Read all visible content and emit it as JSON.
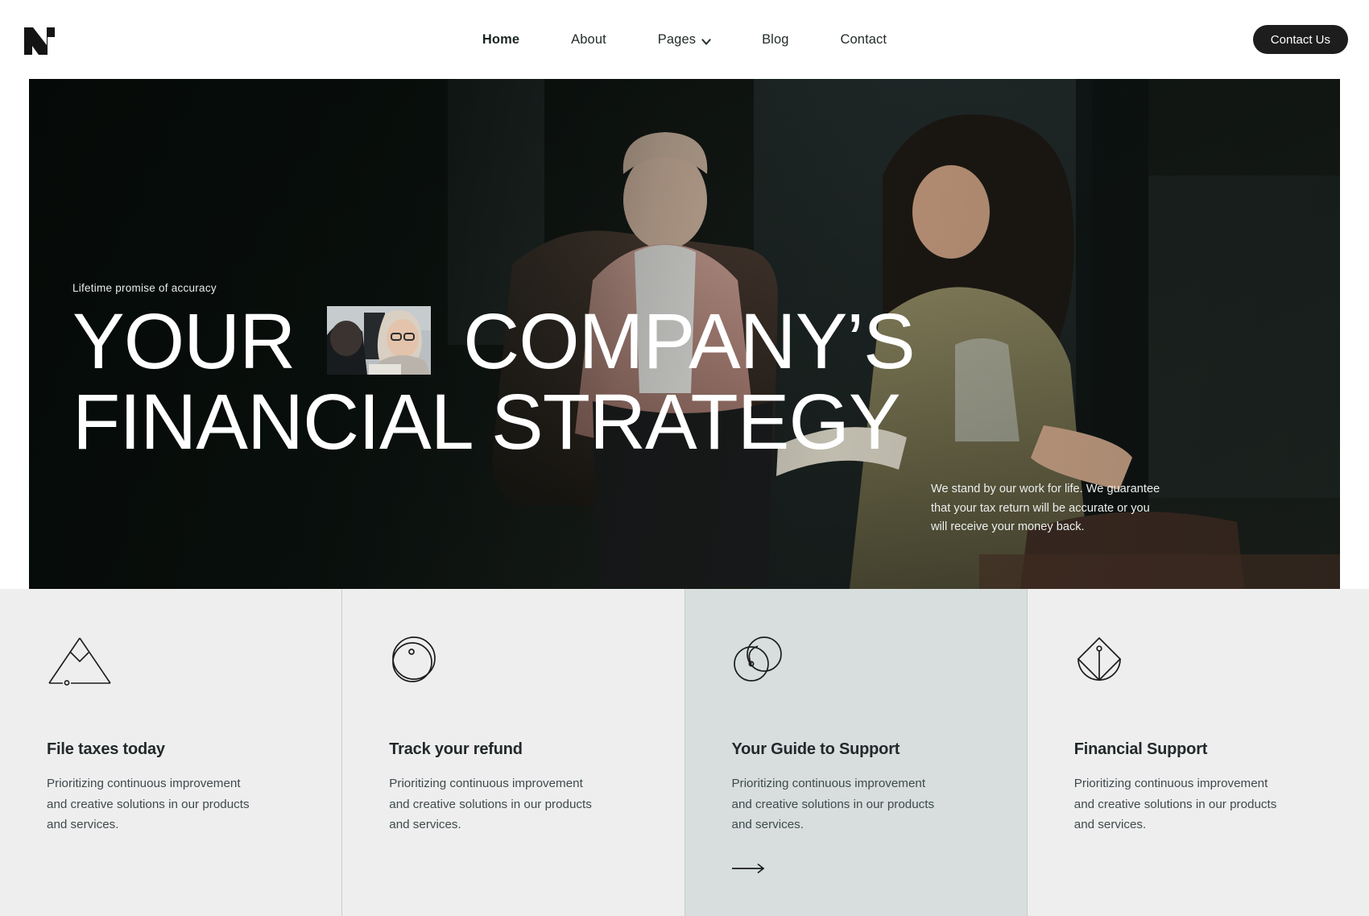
{
  "header": {
    "logo_name": "n-logo",
    "nav": [
      {
        "label": "Home",
        "active": true,
        "has_dropdown": false
      },
      {
        "label": "About",
        "active": false,
        "has_dropdown": false
      },
      {
        "label": "Pages",
        "active": false,
        "has_dropdown": true
      },
      {
        "label": "Blog",
        "active": false,
        "has_dropdown": false
      },
      {
        "label": "Contact",
        "active": false,
        "has_dropdown": false
      }
    ],
    "cta_label": "Contact Us"
  },
  "hero": {
    "eyebrow": "Lifetime promise of accuracy",
    "headline_part1": "YOUR",
    "headline_part2": "COMPANY’S",
    "headline_line2": "FINANCIAL STRATEGY",
    "note": "We stand by our work for life. We guarantee that your tax return will be accurate or you will receive your money back."
  },
  "cards": [
    {
      "icon": "mountain-peak-icon",
      "title": "File taxes today",
      "desc": "Prioritizing continuous improvement and creative solutions in our products and services.",
      "highlight": false,
      "has_arrow": false
    },
    {
      "icon": "overlapping-circles-icon",
      "title": "Track your refund",
      "desc": "Prioritizing continuous improvement and creative solutions in our products and services.",
      "highlight": false,
      "has_arrow": false
    },
    {
      "icon": "venn-circles-icon",
      "title": "Your Guide to Support",
      "desc": "Prioritizing continuous improvement and creative solutions in our products and services.",
      "highlight": true,
      "has_arrow": true
    },
    {
      "icon": "kite-shield-icon",
      "title": "Financial Support",
      "desc": "Prioritizing continuous improvement and creative solutions in our products and services.",
      "highlight": false,
      "has_arrow": false
    }
  ],
  "colors": {
    "dark": "#1d1d1d",
    "card_bg": "#eeeeee",
    "card_highlight_bg": "#d7dedd",
    "text": "#22292b"
  }
}
